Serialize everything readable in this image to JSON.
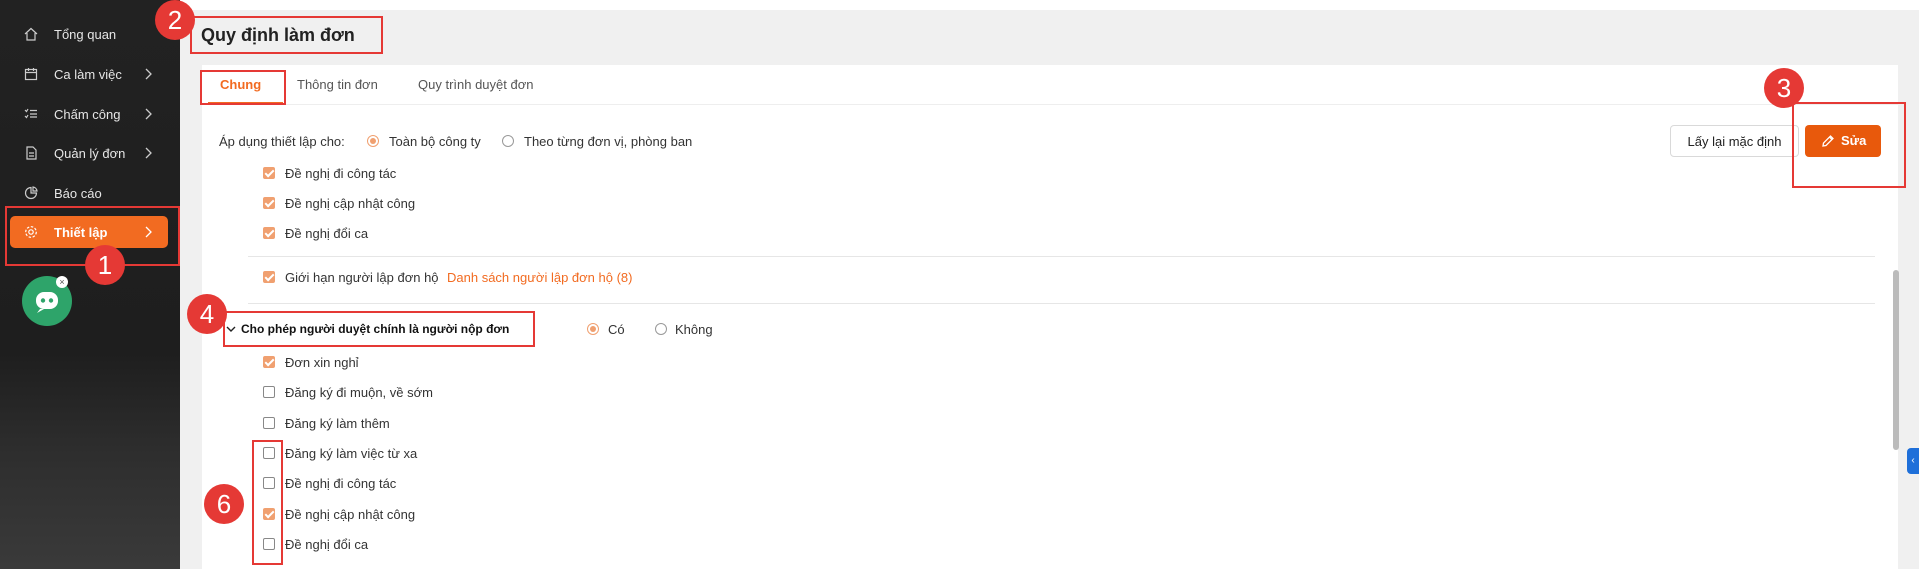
{
  "sidebar": {
    "items": [
      {
        "label": "Tổng quan",
        "icon": "home-icon",
        "chevron": false,
        "active": false
      },
      {
        "label": "Ca làm việc",
        "icon": "calendar-icon",
        "chevron": true,
        "active": false
      },
      {
        "label": "Chấm công",
        "icon": "checklist-icon",
        "chevron": true,
        "active": false
      },
      {
        "label": "Quản lý đơn",
        "icon": "document-icon",
        "chevron": true,
        "active": false
      },
      {
        "label": "Báo cáo",
        "icon": "pie-chart-icon",
        "chevron": false,
        "active": false
      },
      {
        "label": "Thiết lập",
        "icon": "gear-icon",
        "chevron": true,
        "active": true
      }
    ],
    "chatbot_close": "×"
  },
  "page": {
    "title": "Quy định làm đơn"
  },
  "tabs": [
    {
      "label": "Chung",
      "active": true
    },
    {
      "label": "Thông tin đơn",
      "active": false
    },
    {
      "label": "Quy trình duyệt đơn",
      "active": false
    }
  ],
  "apply_scope": {
    "label": "Áp dụng thiết lập cho:",
    "options": [
      {
        "label": "Toàn bộ công ty",
        "selected": true
      },
      {
        "label": "Theo từng đơn vị, phòng ban",
        "selected": false
      }
    ]
  },
  "buttons": {
    "reset": "Lấy lại mặc định",
    "edit": "Sửa"
  },
  "top_checks": [
    {
      "label": "Đề nghị đi công tác",
      "checked": true
    },
    {
      "label": "Đề nghị cập nhật công",
      "checked": true
    },
    {
      "label": "Đề nghị đổi ca",
      "checked": true
    }
  ],
  "proxy_limit": {
    "label": "Giới hạn người lập đơn hộ",
    "checked": true,
    "link": "Danh sách người lập đơn hộ (8)"
  },
  "approver_section": {
    "title": "Cho phép người duyệt chính là người nộp đơn",
    "options": [
      {
        "label": "Có",
        "selected": true
      },
      {
        "label": "Không",
        "selected": false
      }
    ],
    "items": [
      {
        "label": "Đơn xin nghỉ",
        "checked": true
      },
      {
        "label": "Đăng ký đi muộn, về sớm",
        "checked": false
      },
      {
        "label": "Đăng ký làm thêm",
        "checked": false
      },
      {
        "label": "Đăng ký làm việc từ xa",
        "checked": false
      },
      {
        "label": "Đề nghị đi công tác",
        "checked": false
      },
      {
        "label": "Đề nghị cập nhật công",
        "checked": true
      },
      {
        "label": "Đề nghị đổi ca",
        "checked": false
      }
    ]
  },
  "annotations": [
    "1",
    "2",
    "3",
    "4",
    "6"
  ],
  "colors": {
    "accent": "#f26b21",
    "annotation": "#e53935",
    "sidebar": "#222222",
    "check": "#f0a070"
  }
}
